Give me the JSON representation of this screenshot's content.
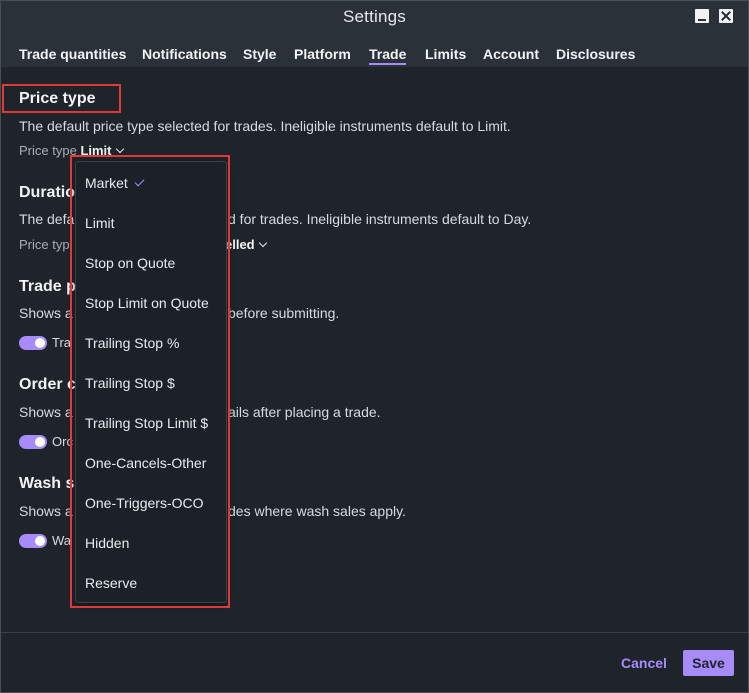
{
  "window": {
    "title": "Settings"
  },
  "tabs": [
    {
      "label": "Trade quantities"
    },
    {
      "label": "Notifications"
    },
    {
      "label": "Style"
    },
    {
      "label": "Platform"
    },
    {
      "label": "Trade",
      "active": true
    },
    {
      "label": "Limits"
    },
    {
      "label": "Account"
    },
    {
      "label": "Disclosures"
    }
  ],
  "sections": {
    "price_type": {
      "title": "Price type",
      "description": "The default price type selected for trades. Ineligible instruments default to Limit.",
      "row_label": "Price type",
      "row_value": "Limit"
    },
    "duration": {
      "title": "Duratio",
      "description_left": "The defa",
      "description_right": "d for trades. Ineligible instruments default to Day.",
      "row_label": "Price typ",
      "row_value": "elled"
    },
    "trade_preview": {
      "title": "Trade p",
      "description_left": "Shows a",
      "description_right": "before submitting.",
      "toggle_label": "Tra",
      "toggle_on": true
    },
    "order_confirmation": {
      "title": "Order c",
      "description_left": "Shows a",
      "description_right": "ails after placing a trade.",
      "toggle_label": "Orc",
      "toggle_on": true
    },
    "wash_sale": {
      "title": "Wash s",
      "description_left": "Shows a",
      "description_right": "des where wash sales apply.",
      "toggle_label": "Wa",
      "toggle_on": true
    }
  },
  "dropdown": {
    "selected": "Market",
    "options": [
      "Market",
      "Limit",
      "Stop on Quote",
      "Stop Limit on Quote",
      "Trailing Stop %",
      "Trailing Stop $",
      "Trailing Stop Limit $",
      "One-Cancels-Other",
      "One-Triggers-OCO",
      "Hidden",
      "Reserve"
    ]
  },
  "footer": {
    "cancel_label": "Cancel",
    "save_label": "Save"
  },
  "colors": {
    "accent": "#a78bfa",
    "highlight_box": "#e0393a",
    "background": "#1f242b"
  }
}
